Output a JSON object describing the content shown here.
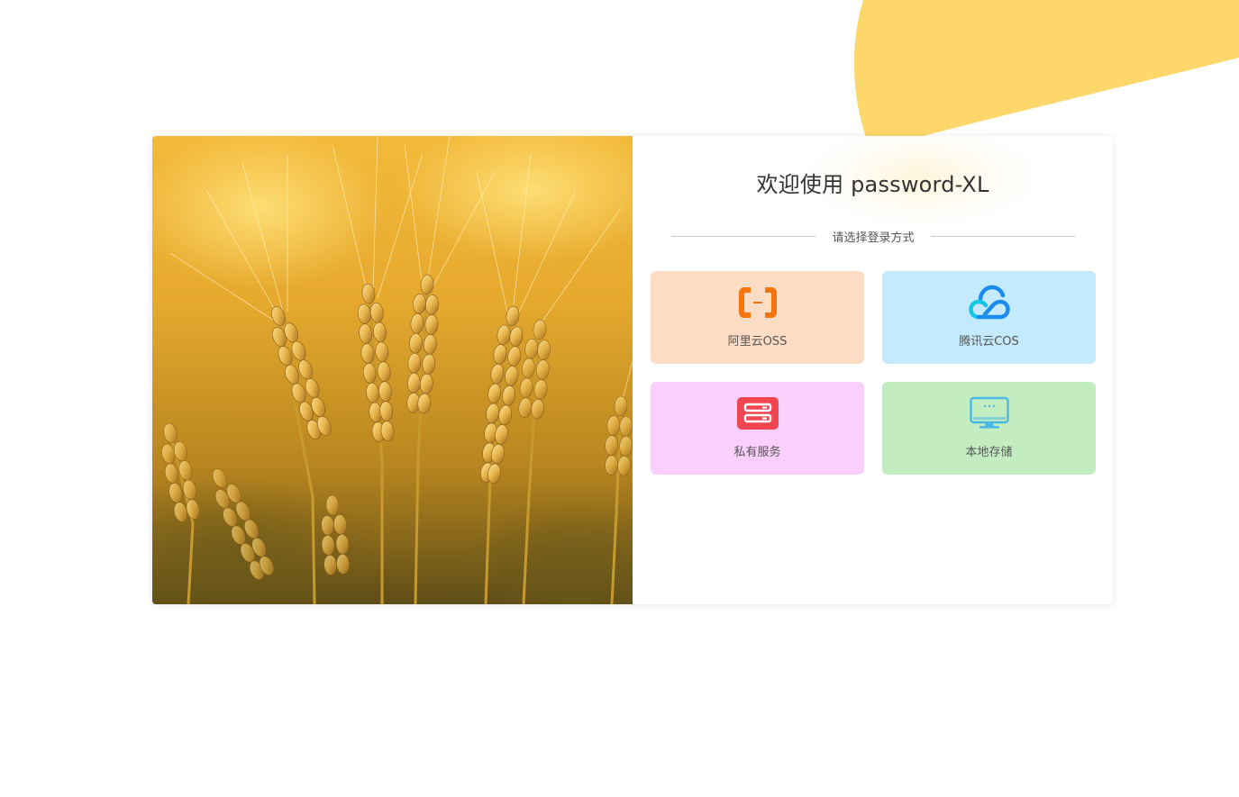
{
  "colors": {
    "blob": "#fdd76a",
    "aliyun_bg": "#ffdcc4",
    "tencent_bg": "#c3eafd",
    "private_bg": "#fbcffc",
    "local_bg": "#c3edc1",
    "aliyun_icon": "#f5750f",
    "tencent_icon_blue": "#1a8cf0",
    "tencent_icon_cyan": "#14c6e8",
    "private_icon": "#f04652",
    "local_icon": "#4ab8e6"
  },
  "login": {
    "title": "欢迎使用 password-XL",
    "prompt": "请选择登录方式",
    "options": [
      {
        "label": "阿里云OSS",
        "icon": "aliyun-icon"
      },
      {
        "label": "腾讯云COS",
        "icon": "tencent-cloud-icon"
      },
      {
        "label": "私有服务",
        "icon": "server-icon"
      },
      {
        "label": "本地存储",
        "icon": "monitor-icon"
      }
    ]
  }
}
